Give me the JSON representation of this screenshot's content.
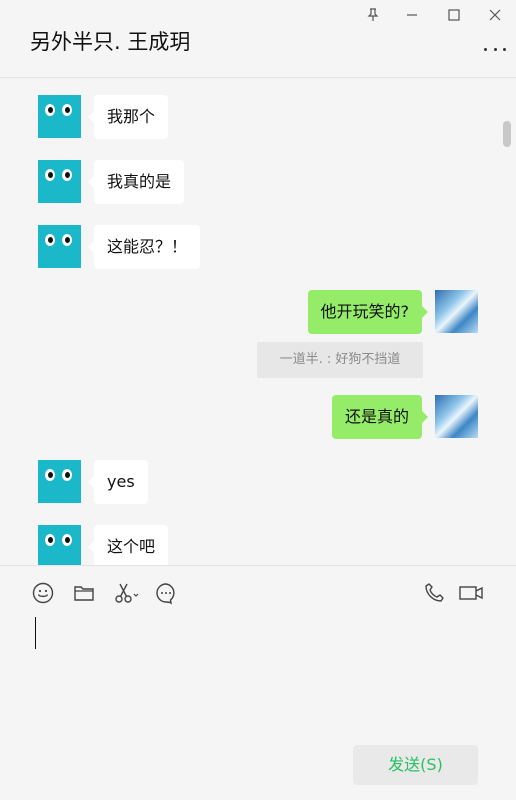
{
  "window": {
    "title": "另外半只. 王成玥",
    "controls": [
      "pin-icon",
      "minimize-icon",
      "maximize-icon",
      "close-icon"
    ]
  },
  "messages": [
    {
      "side": "in",
      "text": "我那个"
    },
    {
      "side": "in",
      "text": "我真的是"
    },
    {
      "side": "in",
      "text": "这能忍？！"
    },
    {
      "side": "out",
      "text": "他开玩笑的?"
    },
    {
      "side": "system",
      "text": "一道半. : 好狗不挡道"
    },
    {
      "side": "out",
      "text": "还是真的"
    },
    {
      "side": "in",
      "text": "yes"
    },
    {
      "side": "in",
      "text": "这个吧"
    }
  ],
  "toolbar": {
    "left_tools": [
      "emoji-icon",
      "folder-icon",
      "scissors-icon",
      "chat-history-icon"
    ],
    "right_tools": [
      "phone-icon",
      "video-icon"
    ]
  },
  "composer": {
    "value": "",
    "send_label": "发送(S)"
  },
  "colors": {
    "background": "#f5f5f5",
    "incoming_bubble": "#ffffff",
    "outgoing_bubble": "#95ec69",
    "send_text": "#27c163",
    "bot_avatar": "#1ab8c9"
  }
}
